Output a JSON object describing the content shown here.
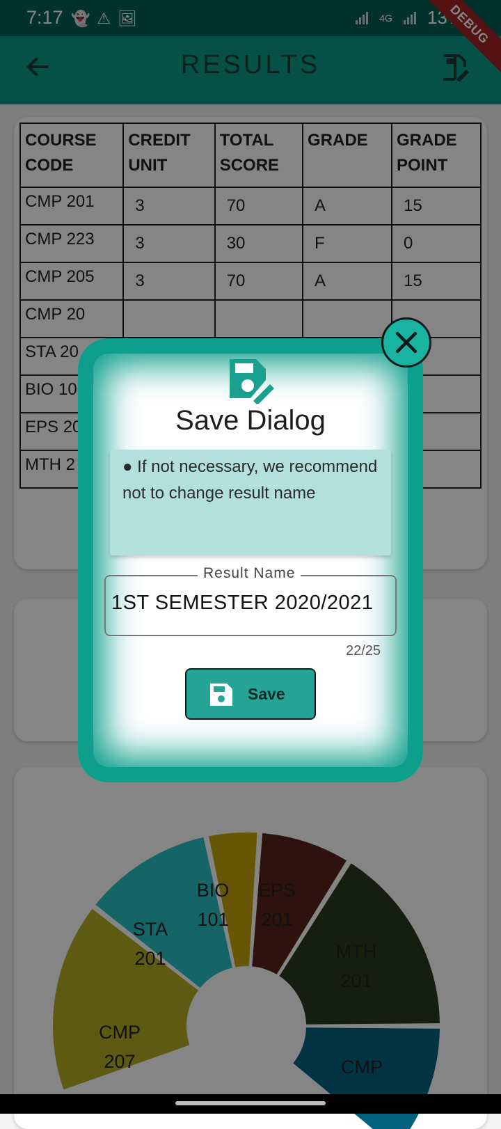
{
  "status_bar": {
    "time": "7:17",
    "network": "4G",
    "battery": "13%"
  },
  "app_bar": {
    "title": "RESULTS",
    "debug_banner": "DEBUG"
  },
  "table": {
    "headers": [
      [
        "COURSE",
        "CODE"
      ],
      [
        "CREDIT",
        "UNIT"
      ],
      [
        "TOTAL",
        "SCORE"
      ],
      [
        "GRADE",
        ""
      ],
      [
        "GRADE",
        "POINT"
      ]
    ],
    "rows": [
      [
        "CMP 201",
        "3",
        "70",
        "A",
        "15"
      ],
      [
        "CMP 223",
        "3",
        "30",
        "F",
        "0"
      ],
      [
        "CMP 205",
        "3",
        "70",
        "A",
        "15"
      ],
      [
        "CMP 20",
        "",
        "",
        "",
        ""
      ],
      [
        "STA 20",
        "",
        "",
        "",
        ""
      ],
      [
        "BIO 10",
        "",
        "",
        "",
        ""
      ],
      [
        "EPS 20",
        "",
        "",
        "",
        ""
      ],
      [
        "MTH 2",
        "",
        "",
        "",
        ""
      ]
    ]
  },
  "chart_data": {
    "type": "pie",
    "slices": [
      {
        "label": [
          "CMP",
          "207"
        ],
        "color": "#b6ad24"
      },
      {
        "label": [
          "STA",
          "201"
        ],
        "color": "#2ac1c6"
      },
      {
        "label": [
          "BIO",
          "101"
        ],
        "color": "#c7a50f"
      },
      {
        "label": [
          "EPS",
          "201"
        ],
        "color": "#57241a"
      },
      {
        "label": [
          "MTH",
          "201"
        ],
        "color": "#2a3a1f"
      },
      {
        "label": [
          "CMP",
          ""
        ],
        "color": "#05627f"
      }
    ]
  },
  "dialog": {
    "title": "Save Dialog",
    "note": "● If not necessary, we recommend not to change result name",
    "field_label": "Result Name",
    "field_value": "1ST SEMESTER 2020/2021",
    "counter": "22/25",
    "save_label": "Save"
  }
}
